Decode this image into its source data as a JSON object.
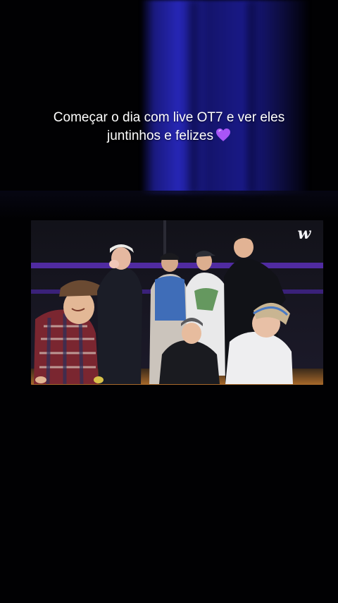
{
  "caption": {
    "line1": "Começar o dia com live OT7 e ver eles",
    "line2": "juntinhos e felizes",
    "emoji": "purple-heart"
  },
  "video": {
    "watermark": "w"
  },
  "colors": {
    "background": "#010103",
    "curtain_blue": "#2a2ab8",
    "caption_text": "#ffffff",
    "heart": "#a855f7",
    "stage_purple_light": "#6d3bd6"
  }
}
